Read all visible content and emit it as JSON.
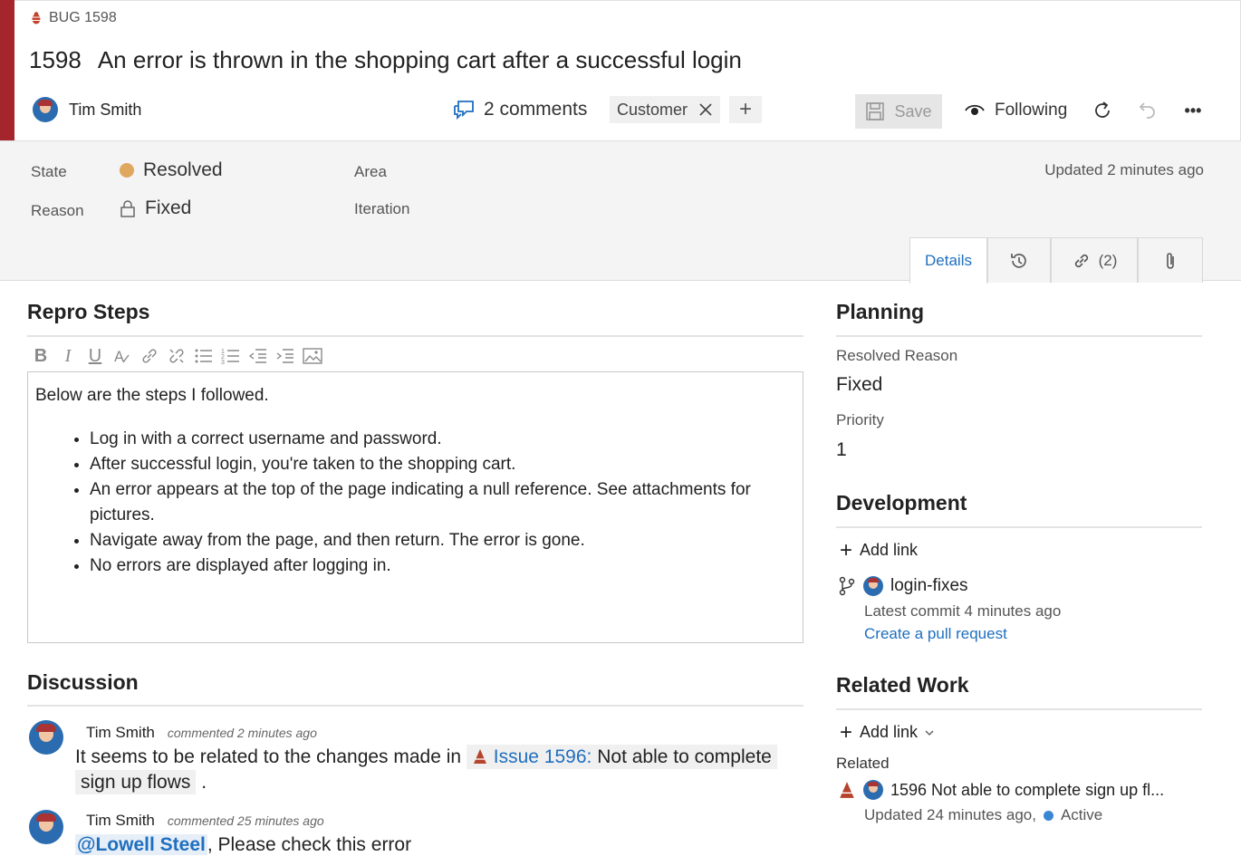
{
  "work_item": {
    "type_label": "BUG 1598",
    "id": "1598",
    "title": "An error is thrown in the shopping cart after a successful login",
    "assigned_to": "Tim Smith",
    "comments_label": "2 comments",
    "tag": "Customer",
    "add_tag": "+"
  },
  "toolbar": {
    "save_label": "Save",
    "following_label": "Following",
    "more_label": "•••"
  },
  "fields": {
    "state_label": "State",
    "state_value": "Resolved",
    "reason_label": "Reason",
    "reason_value": "Fixed",
    "area_label": "Area",
    "iteration_label": "Iteration",
    "updated": "Updated 2 minutes ago"
  },
  "tabs": {
    "details": "Details",
    "links_count": "(2)"
  },
  "repro": {
    "title": "Repro Steps",
    "intro": "Below are the steps I followed.",
    "steps": [
      "Log in with a correct username and password.",
      "After successful login, you're taken to the shopping cart.",
      "An error appears at the top of the page indicating a null reference. See attachments for pictures.",
      "Navigate away from the page, and then return.  The error is gone.",
      "No errors are displayed after logging in."
    ]
  },
  "discussion": {
    "title": "Discussion",
    "comments": [
      {
        "author": "Tim Smith",
        "meta": "commented 2 minutes ago",
        "text_before": "It seems to be related to the changes made in",
        "link_text": "Issue 1596:",
        "link_rest": "Not able to complete",
        "link_rest2": "sign up flows",
        "text_after": "."
      },
      {
        "author": "Tim Smith",
        "meta": "commented 25 minutes ago",
        "mention": "@Lowell Steel",
        "text": ", Please check this error"
      }
    ]
  },
  "planning": {
    "title": "Planning",
    "resolved_reason_label": "Resolved Reason",
    "resolved_reason_value": "Fixed",
    "priority_label": "Priority",
    "priority_value": "1"
  },
  "development": {
    "title": "Development",
    "add_link": "Add link",
    "branch": "login-fixes",
    "commit_info": "Latest commit 4 minutes ago",
    "create_pr": "Create a pull request"
  },
  "related_work": {
    "title": "Related Work",
    "add_link": "Add link",
    "related_label": "Related",
    "item_title": "1596 Not able to complete sign up fl...",
    "item_updated": "Updated 24 minutes ago,",
    "item_state": "Active"
  },
  "colors": {
    "bug_stripe": "#a4262c",
    "resolved": "#e0a75e",
    "active": "#3a85d4",
    "link": "#1f6fbf"
  }
}
